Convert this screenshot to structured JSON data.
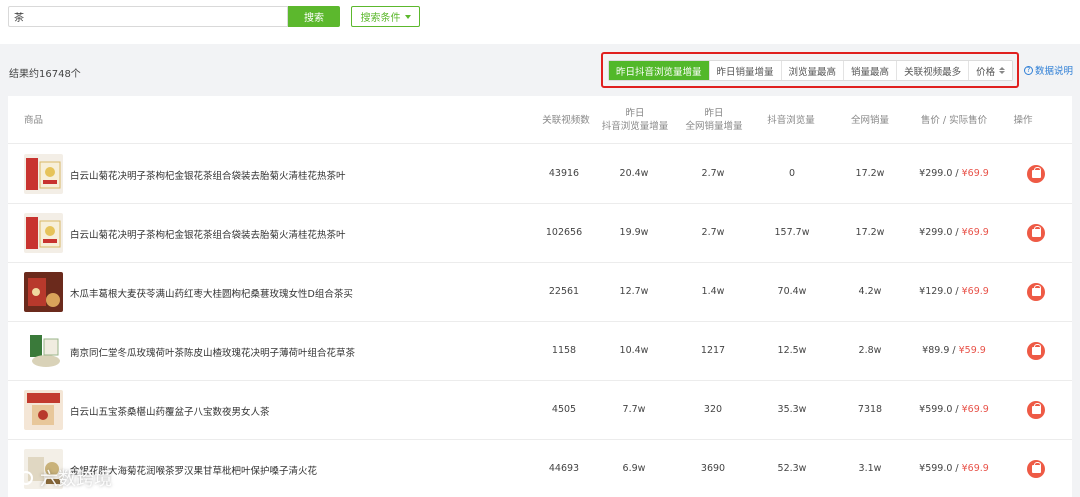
{
  "search": {
    "value": "茶",
    "button_label": "搜索",
    "conditions_label": "搜索条件"
  },
  "results": {
    "count_text": "结果约16748个"
  },
  "sort_tabs": [
    {
      "label": "昨日抖音浏览量增量",
      "active": true
    },
    {
      "label": "昨日销量增量",
      "active": false
    },
    {
      "label": "浏览量最高",
      "active": false
    },
    {
      "label": "销量最高",
      "active": false
    },
    {
      "label": "关联视频最多",
      "active": false
    },
    {
      "label": "价格",
      "active": false
    }
  ],
  "data_help_label": "数据说明",
  "table": {
    "headers": {
      "product": "商品",
      "videos": "关联视频数",
      "views_inc_l1": "昨日",
      "views_inc_l2": "抖音浏览量增量",
      "sales_inc_l1": "昨日",
      "sales_inc_l2": "全网销量增量",
      "views": "抖音浏览量",
      "sales": "全网销量",
      "price": "售价 / 实际售价",
      "action": "操作"
    },
    "rows": [
      {
        "name": "白云山菊花决明子茶枸杞金银花茶组合袋装去胎菊火清桂花热茶叶",
        "videos": "43916",
        "views_inc": "20.4w",
        "sales_inc": "2.7w",
        "views": "0",
        "sales": "17.2w",
        "price": "¥299.0 / ",
        "actual_price": "¥69.9"
      },
      {
        "name": "白云山菊花决明子茶枸杞金银花茶组合袋装去胎菊火清桂花热茶叶",
        "videos": "102656",
        "views_inc": "19.9w",
        "sales_inc": "2.7w",
        "views": "157.7w",
        "sales": "17.2w",
        "price": "¥299.0 / ",
        "actual_price": "¥69.9"
      },
      {
        "name": "木瓜丰葛根大麦茯苓满山药红枣大桂圆枸杞桑葚玫瑰女性D组合茶买",
        "videos": "22561",
        "views_inc": "12.7w",
        "sales_inc": "1.4w",
        "views": "70.4w",
        "sales": "4.2w",
        "price": "¥129.0 / ",
        "actual_price": "¥69.9"
      },
      {
        "name": "南京同仁堂冬瓜玫瑰荷叶茶陈皮山楂玫瑰花决明子薄荷叶组合花草茶",
        "videos": "1158",
        "views_inc": "10.4w",
        "sales_inc": "1217",
        "views": "12.5w",
        "sales": "2.8w",
        "price": "¥89.9 / ",
        "actual_price": "¥59.9"
      },
      {
        "name": "白云山五宝茶桑椹山药覆盆子八宝数夜男女人茶",
        "videos": "4505",
        "views_inc": "7.7w",
        "sales_inc": "320",
        "views": "35.3w",
        "sales": "7318",
        "price": "¥599.0 / ",
        "actual_price": "¥69.9"
      },
      {
        "name": "金银花胖大海菊花润喉茶罗汉果甘草枇杷叶保护嗓子清火花",
        "videos": "44693",
        "views_inc": "6.9w",
        "sales_inc": "3690",
        "views": "52.3w",
        "sales": "3.1w",
        "price": "¥599.0 / ",
        "actual_price": "¥69.9"
      }
    ]
  },
  "watermark": "六数跨境",
  "colors": {
    "accent_green": "#52b82a",
    "highlight_red": "#e0201f",
    "action_orange": "#ee5a45",
    "link_blue": "#2f7fd6"
  }
}
